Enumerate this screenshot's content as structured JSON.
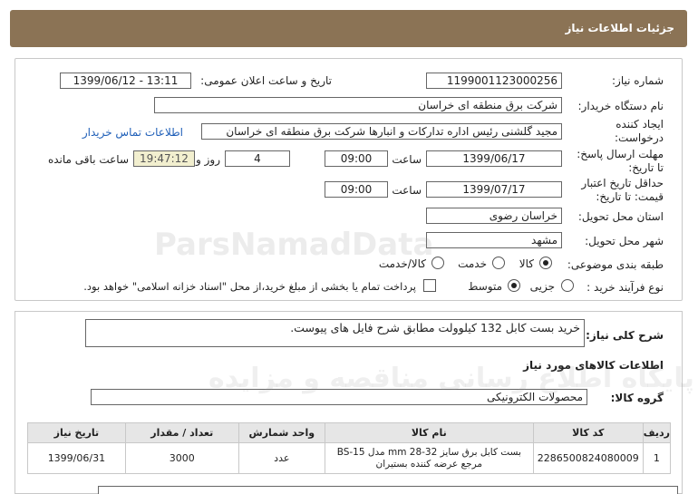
{
  "header": {
    "title": "جزئیات اطلاعات نیاز"
  },
  "form": {
    "need_number_label": "شماره نیاز:",
    "need_number": "1199001123000256",
    "announce_label": "تاریخ و ساعت اعلان عمومی:",
    "announce_value": "1399/06/12 - 13:11",
    "buyer_org_label": "نام دستگاه خریدار:",
    "buyer_org": "شرکت برق منطقه ای خراسان",
    "creator_label_1": "ایجاد کننده",
    "creator_label_2": "درخواست:",
    "creator": "مجید گلشنی رئیس اداره تدارکات و انبارها شرکت برق منطقه ای خراسان",
    "contact_link": "اطلاعات تماس خریدار",
    "deadline_label_1": "مهلت ارسال پاسخ:",
    "deadline_label_2": "تا تاریخ:",
    "deadline_date": "1399/06/17",
    "time_label": "ساعت",
    "deadline_time": "09:00",
    "days_value": "4",
    "days_label": "روز و",
    "remaining_time": "19:47:12",
    "remaining_label": "ساعت باقی مانده",
    "validity_label_1": "حداقل تاریخ اعتبار",
    "validity_label_2": "قیمت: تا تاریخ:",
    "validity_date": "1399/07/17",
    "validity_time": "09:00",
    "province_label": "استان محل تحویل:",
    "province": "خراسان رضوی",
    "city_label": "شهر محل تحویل:",
    "city": "مشهد",
    "category_label": "طبقه بندی موضوعی:",
    "category_options": [
      "کالا",
      "خدمت",
      "کالا/خدمت"
    ],
    "category_selected": "کالا",
    "purchase_label": "نوع فرآیند خرید :",
    "purchase_options": [
      "جزیی",
      "متوسط"
    ],
    "purchase_selected": "متوسط",
    "payment_note": "پرداخت تمام یا بخشی از مبلغ خرید،از محل \"اسناد خزانه اسلامی\" خواهد بود."
  },
  "summary": {
    "label": "شرح کلی نیاز:",
    "text": "خرید بست کابل 132 کیلوولت مطابق شرح فایل های پیوست."
  },
  "goods": {
    "section_title": "اطلاعات کالاهای مورد نیاز",
    "group_label": "گروه کالا:",
    "group_value": "محصولات الکترونیکی",
    "columns": [
      "ردیف",
      "کد کالا",
      "نام کالا",
      "واحد شمارش",
      "تعداد / مقدار",
      "تاریخ نیاز"
    ],
    "rows": [
      [
        "1",
        "2286500824080009",
        "بست کابل برق سایز mm 28-32 مدل BS-15 مرجع عرضه کننده بستیران",
        "عدد",
        "3000",
        "1399/06/31"
      ]
    ]
  },
  "watermark": {
    "line1": "ParsNamadData",
    "line2": "پایگاه اطلاع رسانی مناقصه و مزایده"
  }
}
